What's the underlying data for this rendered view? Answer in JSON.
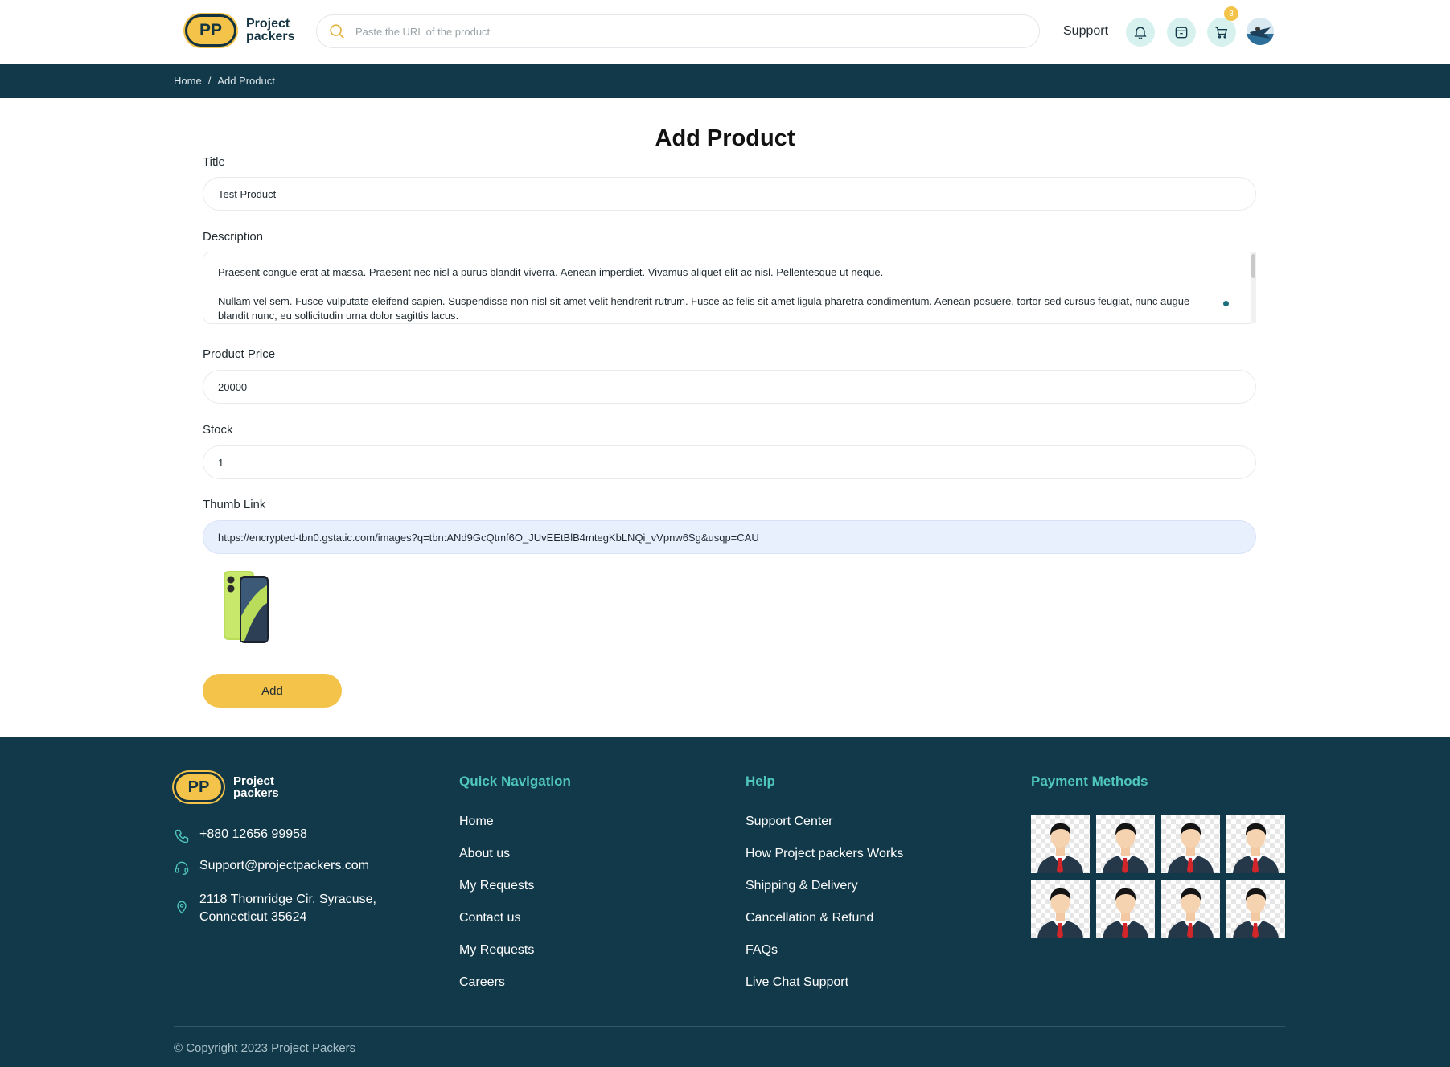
{
  "header": {
    "logo_badge": "PP",
    "logo_line1": "Project",
    "logo_line2": "packers",
    "search_placeholder": "Paste the URL of the product",
    "support_label": "Support",
    "cart_count": "3"
  },
  "breadcrumb": {
    "home": "Home",
    "separator": "/",
    "current": "Add Product"
  },
  "form": {
    "title": "Add Product",
    "title_label": "Title",
    "title_value": "Test Product",
    "description_label": "Description",
    "description_p1": "Praesent congue erat at massa. Praesent nec nisl a purus blandit viverra. Aenean imperdiet. Vivamus aliquet elit ac nisl. Pellentesque ut neque.",
    "description_p2": "Nullam vel sem. Fusce vulputate eleifend sapien. Suspendisse non nisl sit amet velit hendrerit rutrum. Fusce ac felis sit amet ligula pharetra condimentum. Aenean posuere, tortor sed cursus feugiat, nunc augue blandit nunc, eu sollicitudin urna dolor sagittis lacus.",
    "price_label": "Product Price",
    "price_value": "20000",
    "stock_label": "Stock",
    "stock_value": "1",
    "thumb_label": "Thumb Link",
    "thumb_value": "https://encrypted-tbn0.gstatic.com/images?q=tbn:ANd9GcQtmf6O_JUvEEtBlB4mtegKbLNQi_vVpnw6Sg&usqp=CAU",
    "add_button": "Add"
  },
  "footer": {
    "logo_badge": "PP",
    "logo_line1": "Project",
    "logo_line2": "packers",
    "phone": "+880 12656 99958",
    "email": "Support@projectpackers.com",
    "address_line1": "2118 Thornridge Cir. Syracuse,",
    "address_line2": "Connecticut 35624",
    "quick_nav_heading": "Quick Navigation",
    "quick_nav": [
      "Home",
      "About us",
      "My Requests",
      "Contact us",
      "My Requests",
      "Careers"
    ],
    "help_heading": "Help",
    "help": [
      "Support Center",
      "How Project packers Works",
      "Shipping & Delivery",
      "Cancellation & Refund",
      "FAQs",
      "Live Chat Support"
    ],
    "payment_heading": "Payment Methods",
    "copyright": "© Copyright 2023 Project Packers"
  },
  "colors": {
    "brand_dark": "#12394a",
    "brand_yellow": "#f4c44a",
    "accent_teal": "#4fc7bd",
    "icon_bg": "#d6f1ee"
  },
  "icons": [
    "search-icon",
    "bell-icon",
    "package-icon",
    "cart-icon",
    "phone-icon",
    "headset-icon",
    "location-pin-icon"
  ]
}
